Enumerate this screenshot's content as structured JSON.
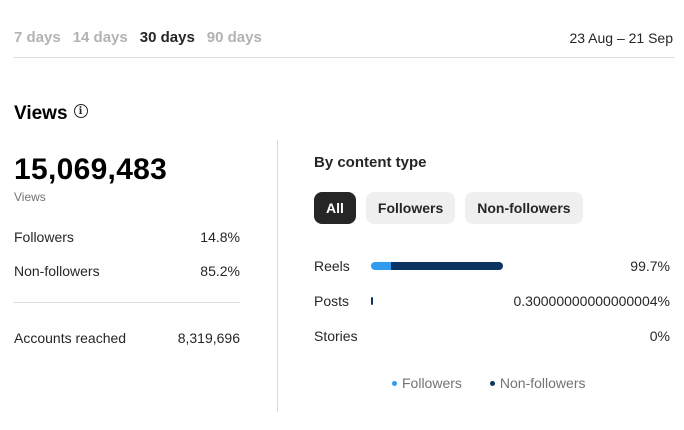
{
  "range_tabs": [
    {
      "label": "7 days",
      "active": false
    },
    {
      "label": "14 days",
      "active": false
    },
    {
      "label": "30 days",
      "active": true
    },
    {
      "label": "90 days",
      "active": false
    }
  ],
  "date_range": "23 Aug – 21 Sep",
  "views": {
    "title": "Views",
    "total": "15,069,483",
    "total_label": "Views",
    "breakdown": [
      {
        "label": "Followers",
        "value": "14.8%"
      },
      {
        "label": "Non-followers",
        "value": "85.2%"
      }
    ],
    "accounts_reached": {
      "label": "Accounts reached",
      "value": "8,319,696"
    }
  },
  "content_type": {
    "title": "By content type",
    "filters": [
      {
        "label": "All",
        "active": true
      },
      {
        "label": "Followers",
        "active": false
      },
      {
        "label": "Non-followers",
        "active": false
      }
    ],
    "rows": [
      {
        "label": "Reels",
        "percent": "99.7%",
        "bar_fraction": 1.0,
        "followers_share": 0.148
      },
      {
        "label": "Posts",
        "percent": "0.30000000000000004%",
        "bar_fraction": 0.0,
        "followers_share": 0.148
      },
      {
        "label": "Stories",
        "percent": "0%",
        "bar_fraction": 0.0,
        "followers_share": 0.0
      }
    ],
    "legend": [
      {
        "label": "Followers",
        "color": "#2f9cef"
      },
      {
        "label": "Non-followers",
        "color": "#0c3463"
      }
    ]
  }
}
